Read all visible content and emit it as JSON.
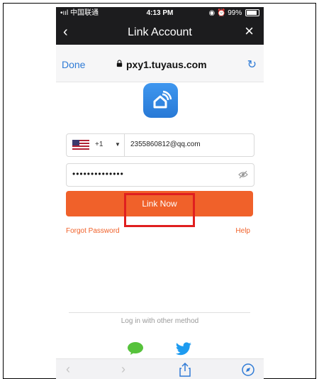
{
  "status_bar": {
    "carrier": "•ııl 中国联通 ",
    "time": "4:13 PM",
    "battery_text": "99%"
  },
  "nav": {
    "title": "Link Account",
    "back_icon": "chevron-left",
    "close_icon": "close-x"
  },
  "browser": {
    "done_label": "Done",
    "url": "pxy1.tuyaus.com",
    "lock_icon": "lock",
    "refresh_icon": "refresh"
  },
  "form": {
    "country_code": "+1",
    "email_value": "2355860812@qq.com",
    "password_mask": "••••••••••••••",
    "link_button_label": "Link Now",
    "forgot_label": "Forgot Password",
    "help_label": "Help"
  },
  "other_methods": {
    "label": "Log in with other method",
    "icons": [
      "wechat",
      "twitter"
    ]
  },
  "toolbar": {
    "icons": [
      "back",
      "forward",
      "share",
      "compass"
    ]
  },
  "colors": {
    "accent": "#f0612a",
    "app_icon_blue": "#2f7bd6",
    "highlight_red": "#e01f1f",
    "wechat_green": "#56c23b",
    "twitter_blue": "#1d9bf0"
  }
}
